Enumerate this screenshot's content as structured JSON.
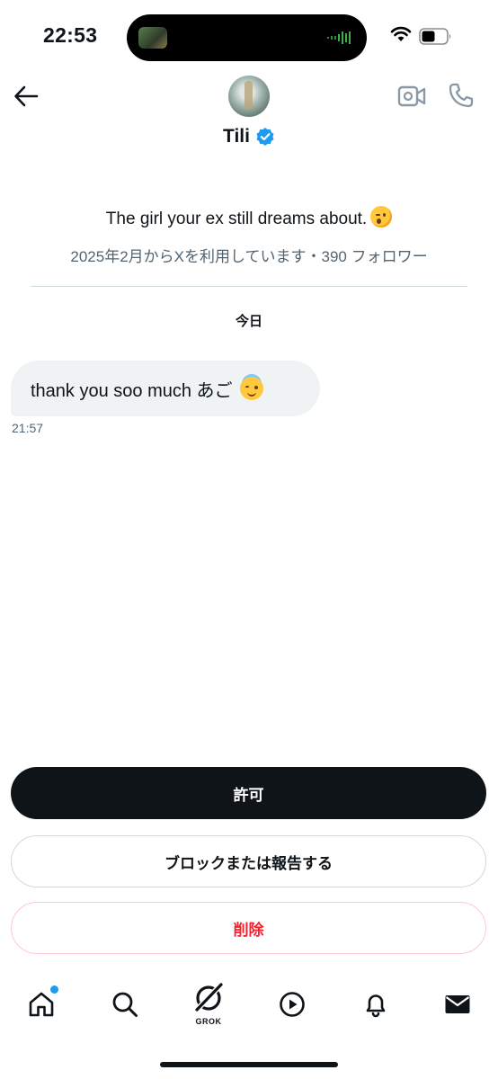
{
  "status_bar": {
    "time": "22:53",
    "icons": [
      "wifi-icon",
      "battery-icon"
    ]
  },
  "header": {
    "name": "Tili",
    "verified": true,
    "icons": [
      "back-arrow-icon",
      "video-call-icon",
      "phone-icon",
      "verified-badge-icon"
    ]
  },
  "profile": {
    "bio": "The girl your ex still dreams about.",
    "bio_emoji": "winking-face",
    "meta": "2025年2月からXを利用しています・390 フォロワー"
  },
  "conversation": {
    "date_label": "今日",
    "messages": [
      {
        "text": "thank you soo much  あご",
        "emoji": "smiling-face-with-halo",
        "time": "21:57"
      }
    ]
  },
  "actions": {
    "allow": "許可",
    "block_report": "ブロックまたは報告する",
    "delete": "削除"
  },
  "bottom_nav": {
    "grok_label": "GROK",
    "items": [
      "home-icon",
      "search-icon",
      "grok-icon",
      "video-icon",
      "notifications-icon",
      "messages-icon"
    ]
  },
  "colors": {
    "primary_text": "#0f1419",
    "secondary_text": "#536471",
    "accent_blue": "#1d9bf0",
    "danger_red": "#f4212e"
  }
}
